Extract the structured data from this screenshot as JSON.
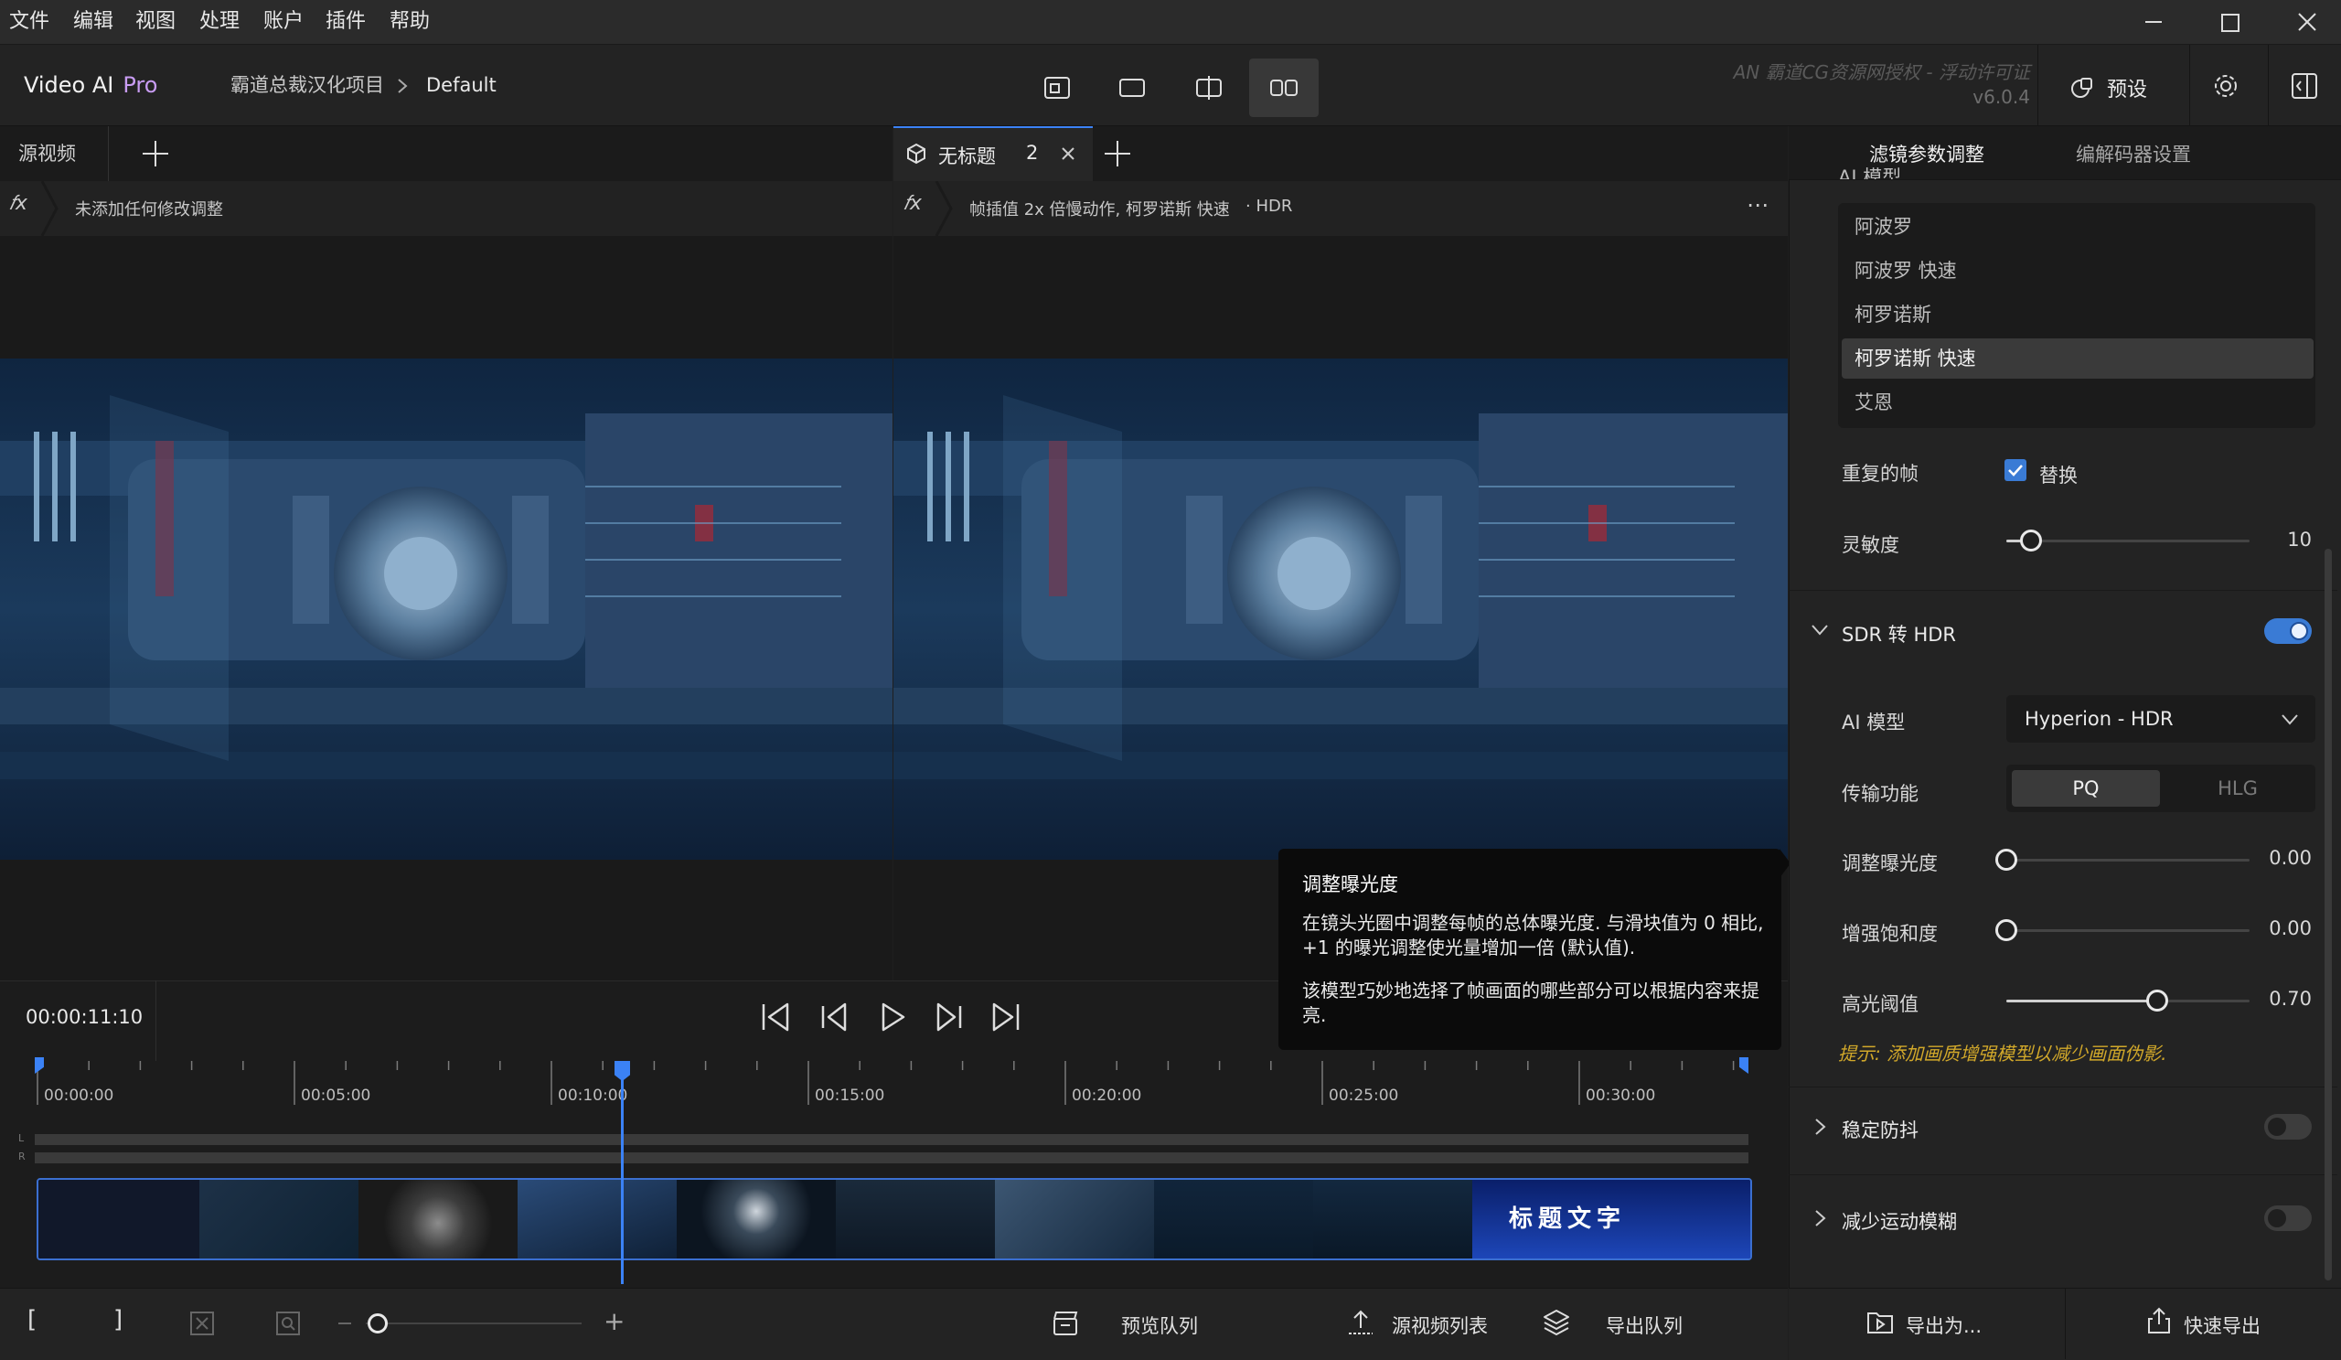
{
  "menu": [
    "文件",
    "编辑",
    "视图",
    "处理",
    "账户",
    "插件",
    "帮助"
  ],
  "app": {
    "name": "Video AI",
    "edition": "Pro"
  },
  "breadcrumb": {
    "project": "霸道总裁汉化项目",
    "current": "Default"
  },
  "watermark": {
    "text": "AN 霸道CG资源网授权 - 浮动许可证",
    "version": "v6.0.4"
  },
  "preset_label": "预设",
  "left_pane": {
    "tab": "源视频",
    "fx_status": "未添加任何修改调整"
  },
  "right_pane": {
    "tab": "无标题",
    "tab_count": "2",
    "fx_status": "帧插值 2x 倍慢动作, 柯罗诺斯 快速",
    "fx_extra": "HDR"
  },
  "timecode": "00:00:11:10",
  "ruler_labels": [
    "00:00:00",
    "00:05:00",
    "00:10:00",
    "00:15:00",
    "00:20:00",
    "00:25:00",
    "00:30:00"
  ],
  "channel_labels": [
    "L",
    "R"
  ],
  "thumbnail_caption": "标题文字",
  "tooltip": {
    "title": "调整曝光度",
    "para1": "在镜头光圈中调整每帧的总体曝光度. 与滑块值为 0 相比, +1 的曝光调整使光量增加一倍 (默认值).",
    "para2": "该模型巧妙地选择了帧画面的哪些部分可以根据内容来提亮."
  },
  "right_panel": {
    "tabs": [
      "滤镜参数调整",
      "编解码器设置"
    ],
    "model_section_label": "AI 模型",
    "models": [
      "阿波罗",
      "阿波罗 快速",
      "柯罗诺斯",
      "柯罗诺斯 快速",
      "艾恩"
    ],
    "selected_model": "柯罗诺斯 快速",
    "dup_frames": {
      "label": "重复的帧",
      "checkbox_label": "替换",
      "checked": true
    },
    "sensitivity": {
      "label": "灵敏度",
      "value": "10",
      "fraction": 0.1
    },
    "sdr_hdr": {
      "title": "SDR 转 HDR",
      "enabled": true
    },
    "ai_model": {
      "label": "AI 模型",
      "value": "Hyperion - HDR"
    },
    "transfer": {
      "label": "传输功能",
      "options": [
        "PQ",
        "HLG"
      ],
      "selected": "PQ"
    },
    "exposure": {
      "label": "调整曝光度",
      "value": "0.00",
      "fraction": 0.0
    },
    "saturation": {
      "label": "增强饱和度",
      "value": "0.00",
      "fraction": 0.0
    },
    "highlight": {
      "label": "高光阈值",
      "value": "0.70",
      "fraction": 0.62
    },
    "hint": "提示: 添加画质增强模型以减少画面伪影.",
    "stabilize": {
      "title": "稳定防抖",
      "enabled": false
    },
    "motion_blur": {
      "title": "减少运动模糊",
      "enabled": false
    }
  },
  "bottom": {
    "preview_queue": "预览队列",
    "source_list": "源视频列表",
    "export_queue": "导出队列",
    "export_as": "导出为...",
    "quick_export": "快速导出"
  },
  "colors": {
    "accent": "#3a7bd5",
    "pro": "#c89cf2",
    "hint": "#d1a82a",
    "playhead": "#3b82f6"
  }
}
